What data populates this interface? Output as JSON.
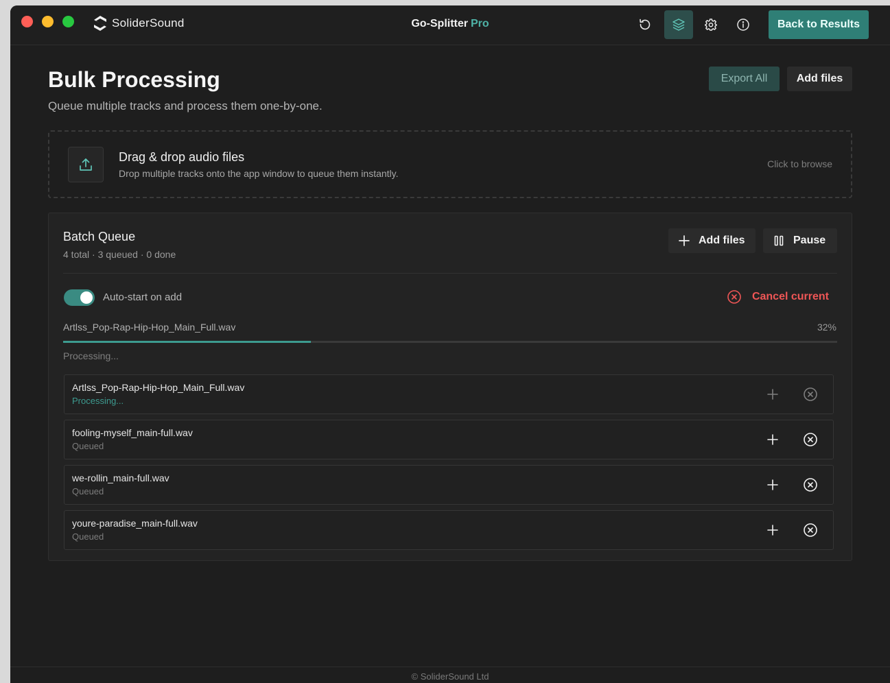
{
  "app": {
    "brand": "SoliderSound",
    "title": "Go-Splitter",
    "title_badge": "Pro",
    "back_button": "Back to Results",
    "accent_color": "#2f7f76",
    "danger_color": "#ef5656"
  },
  "toolbar": {
    "icons": [
      "refresh-icon",
      "layers-icon",
      "gear-icon",
      "info-icon"
    ],
    "active_icon": "layers-icon"
  },
  "header": {
    "title": "Bulk Processing",
    "subtitle": "Queue multiple tracks and process them one-by-one.",
    "export_label": "Export All",
    "add_files_label": "Add files"
  },
  "dropzone": {
    "title": "Drag & drop audio files",
    "description": "Drop multiple tracks onto the app window to queue them instantly.",
    "browse": "Click to browse"
  },
  "batch": {
    "title": "Batch Queue",
    "stats": "4 total · 3 queued · 0 done",
    "add_files_label": "Add files",
    "pause_label": "Pause",
    "auto_start_label": "Auto-start on add",
    "auto_start_on": true,
    "cancel_label": "Cancel current",
    "current_file": "Artlss_Pop-Rap-Hip-Hop_Main_Full.wav",
    "progress_label": "32%",
    "progress": 0.32,
    "status": "Processing..."
  },
  "queue": [
    {
      "name": "Artlss_Pop-Rap-Hip-Hop_Main_Full.wav",
      "status": "Processing...",
      "processing": true
    },
    {
      "name": "fooling-myself_main-full.wav",
      "status": "Queued",
      "processing": false
    },
    {
      "name": "we-rollin_main-full.wav",
      "status": "Queued",
      "processing": false
    },
    {
      "name": "youre-paradise_main-full.wav",
      "status": "Queued",
      "processing": false
    }
  ],
  "footer": {
    "text": "© SoliderSound Ltd"
  }
}
